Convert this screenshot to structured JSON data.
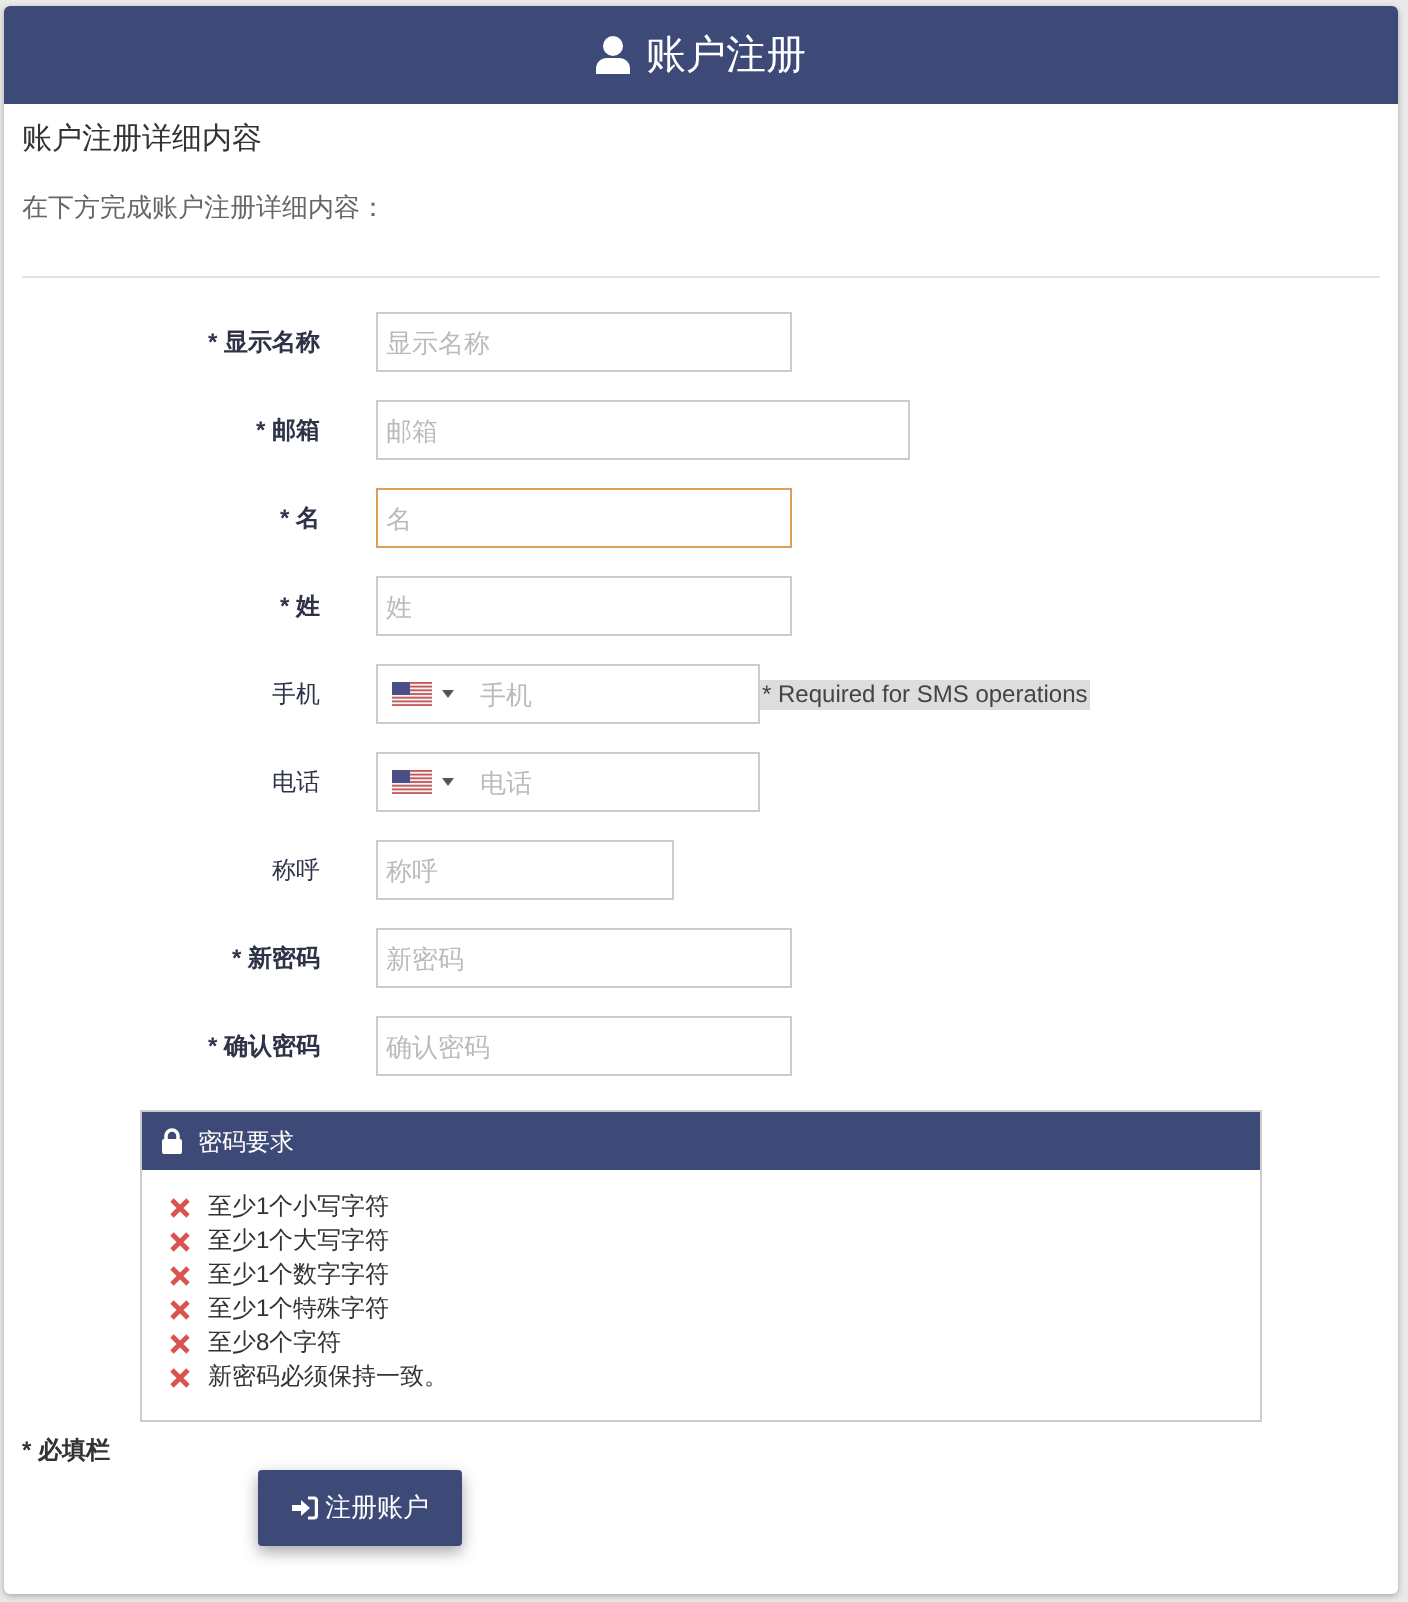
{
  "header": {
    "title": "账户注册"
  },
  "section": {
    "heading": "账户注册详细内容",
    "intro": "在下方完成账户注册详细内容："
  },
  "fields": [
    {
      "kind": "text",
      "label": "* 显示名称",
      "required": true,
      "placeholder": "显示名称",
      "focused": false
    },
    {
      "kind": "email",
      "label": "* 邮箱",
      "required": true,
      "placeholder": "邮箱",
      "focused": false
    },
    {
      "kind": "text",
      "label": "* 名",
      "required": true,
      "placeholder": "名",
      "focused": true
    },
    {
      "kind": "text",
      "label": "* 姓",
      "required": true,
      "placeholder": "姓",
      "focused": false
    },
    {
      "kind": "phone",
      "label": "手机",
      "required": false,
      "placeholder": "手机",
      "focused": false,
      "note": "* Required for SMS operations"
    },
    {
      "kind": "phone",
      "label": "电话",
      "required": false,
      "placeholder": "电话",
      "focused": false
    },
    {
      "kind": "text",
      "label": "称呼",
      "required": false,
      "placeholder": "称呼",
      "focused": false
    },
    {
      "kind": "password",
      "label": "* 新密码",
      "required": true,
      "placeholder": "新密码",
      "focused": false
    },
    {
      "kind": "password",
      "label": "* 确认密码",
      "required": true,
      "placeholder": "确认密码",
      "focused": false
    }
  ],
  "requirements": {
    "title": "密码要求",
    "items": [
      {
        "text": "至少1个小写字符",
        "met": false
      },
      {
        "text": "至少1个大写字符",
        "met": false
      },
      {
        "text": "至少1个数字字符",
        "met": false
      },
      {
        "text": "至少1个特殊字符",
        "met": false
      },
      {
        "text": "至少8个字符",
        "met": false
      },
      {
        "text": "新密码必须保持一致。",
        "met": false
      }
    ]
  },
  "required_note": "* 必填栏",
  "submit": {
    "label": "注册账户"
  }
}
